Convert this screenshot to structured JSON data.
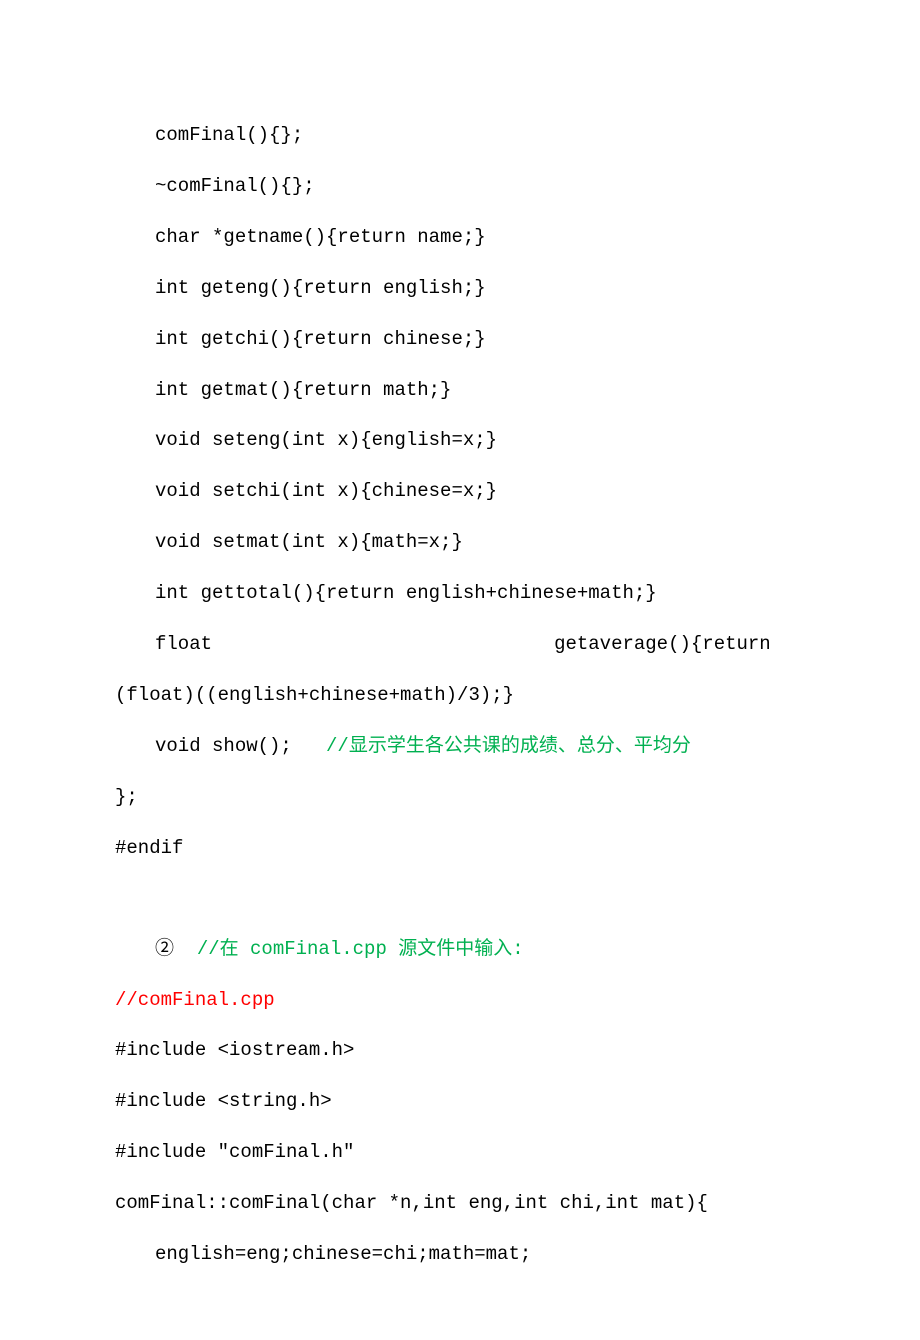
{
  "lines": [
    {
      "indent": true,
      "segments": [
        {
          "text": "comFinal(){};",
          "color": "black"
        }
      ]
    },
    {
      "indent": true,
      "segments": [
        {
          "text": "~comFinal(){};",
          "color": "black"
        }
      ]
    },
    {
      "indent": true,
      "segments": [
        {
          "text": "char *getname(){return name;}",
          "color": "black"
        }
      ]
    },
    {
      "indent": true,
      "segments": [
        {
          "text": "int geteng(){return english;}",
          "color": "black"
        }
      ]
    },
    {
      "indent": true,
      "segments": [
        {
          "text": "int getchi(){return chinese;}",
          "color": "black"
        }
      ]
    },
    {
      "indent": true,
      "segments": [
        {
          "text": "int getmat(){return math;}",
          "color": "black"
        }
      ]
    },
    {
      "indent": true,
      "segments": [
        {
          "text": "void seteng(int x){english=x;}",
          "color": "black"
        }
      ]
    },
    {
      "indent": true,
      "segments": [
        {
          "text": "void setchi(int x){chinese=x;}",
          "color": "black"
        }
      ]
    },
    {
      "indent": true,
      "segments": [
        {
          "text": "void setmat(int x){math=x;}",
          "color": "black"
        }
      ]
    },
    {
      "indent": true,
      "segments": [
        {
          "text": "int gettotal(){return english+chinese+math;}",
          "color": "black"
        }
      ]
    },
    {
      "indent": true,
      "segments": [
        {
          "text": "float                              getaverage(){return",
          "color": "black"
        }
      ]
    },
    {
      "indent": false,
      "segments": [
        {
          "text": "(float)((english+chinese+math)/3);}",
          "color": "black"
        }
      ]
    },
    {
      "indent": true,
      "segments": [
        {
          "text": "void show();   ",
          "color": "black"
        },
        {
          "text": "//显示学生各公共课的成绩、总分、平均分",
          "color": "green"
        }
      ]
    },
    {
      "indent": false,
      "segments": [
        {
          "text": "};",
          "color": "black"
        }
      ]
    },
    {
      "indent": false,
      "segments": [
        {
          "text": "#endif",
          "color": "black"
        }
      ]
    }
  ],
  "section2_header": {
    "indent": true,
    "segments": [
      {
        "text": "②  ",
        "color": "black"
      },
      {
        "text": "//在 comFinal.cpp 源文件中输入:",
        "color": "green"
      }
    ]
  },
  "lines2": [
    {
      "indent": false,
      "segments": [
        {
          "text": "//comFinal.cpp",
          "color": "red"
        }
      ]
    },
    {
      "indent": false,
      "segments": [
        {
          "text": "#include <iostream.h>",
          "color": "black"
        }
      ]
    },
    {
      "indent": false,
      "segments": [
        {
          "text": "#include <string.h>",
          "color": "black"
        }
      ]
    },
    {
      "indent": false,
      "segments": [
        {
          "text": "#include \"comFinal.h\"",
          "color": "black"
        }
      ]
    },
    {
      "indent": false,
      "segments": [
        {
          "text": "comFinal::comFinal(char *n,int eng,int chi,int mat){",
          "color": "black"
        }
      ]
    },
    {
      "indent": true,
      "segments": [
        {
          "text": "english=eng;chinese=chi;math=mat;",
          "color": "black"
        }
      ]
    }
  ]
}
